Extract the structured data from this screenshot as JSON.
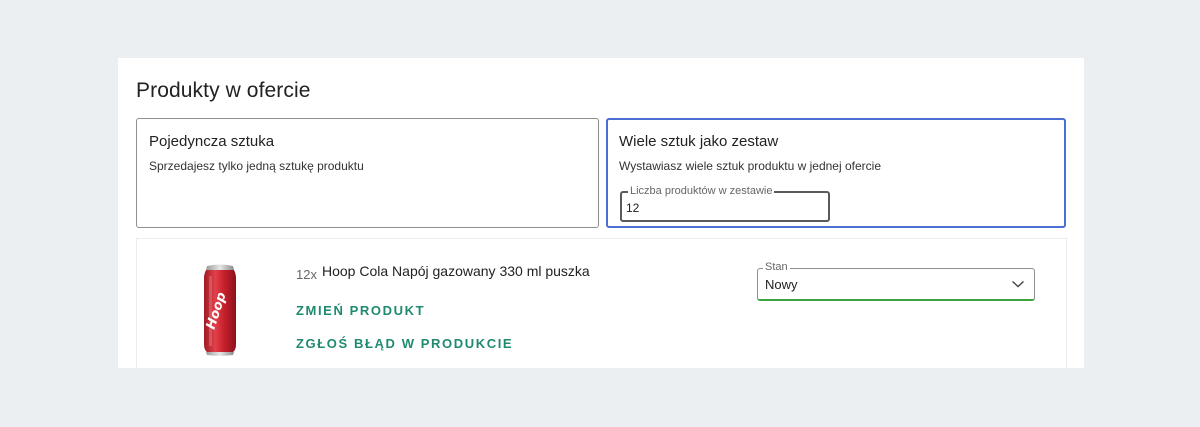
{
  "section": {
    "title": "Produkty w ofercie"
  },
  "options": {
    "single": {
      "title": "Pojedyncza sztuka",
      "description": "Sprzedajesz tylko jedną sztukę produktu"
    },
    "bundle": {
      "title": "Wiele sztuk jako zestaw",
      "description": "Wystawiasz wiele sztuk produktu w jednej ofercie",
      "quantity_label": "Liczba produktów w zestawie",
      "quantity_value": "12",
      "selected": true
    }
  },
  "product": {
    "quantity_prefix": "12x",
    "name": "Hoop Cola Napój gazowany 330 ml puszka",
    "image_icon": "soda-can-icon",
    "brand_text": "Hoop",
    "actions": {
      "change": "ZMIEŃ PRODUKT",
      "report": "ZGŁOŚ BŁĄD W PRODUKCIE"
    },
    "condition": {
      "label": "Stan",
      "value": "Nowy"
    }
  },
  "colors": {
    "accent_selected": "#4b6fd3",
    "link_green": "#1f8a70",
    "valid_green": "#3fa33f",
    "can_red": "#d32f3a"
  }
}
